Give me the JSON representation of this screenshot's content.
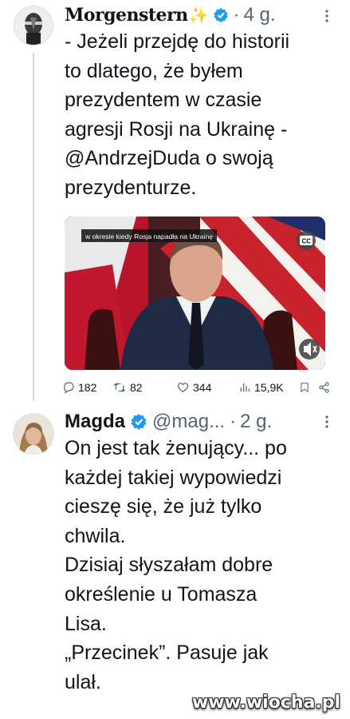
{
  "tweet1": {
    "author_name": "Morgenstern",
    "name_emoji": "✨",
    "time": "4 g.",
    "text_lines": [
      "- Jeżeli przejdę do historii",
      "to dlatego, że byłem",
      "prezydentem w czasie",
      "agresji Rosji na Ukrainę -",
      "@AndrzejDuda o swoją",
      "prezydenturze."
    ],
    "video": {
      "caption": "w okresie kiedy Rosja napadła na Ukrainę",
      "cc_label": "CC"
    },
    "actions": {
      "replies": "182",
      "reposts": "82",
      "likes": "344",
      "views": "15,9K"
    }
  },
  "tweet2": {
    "author_name": "Magda",
    "handle": "@mag...",
    "time": "2 g.",
    "text_lines": [
      "On jest tak żenujący... po",
      "każdej takiej wypowiedzi",
      "cieszę się, że już tylko",
      "chwila.",
      "Dzisiaj słyszałam dobre",
      "określenie u Tomasza",
      "Lisa.",
      "„Przecinek”. Pasuje jak",
      "ulał."
    ]
  },
  "watermark": "www.wiocha.pl",
  "colors": {
    "verified": "#1d9bf0",
    "muted": "#536471",
    "text": "#0f1419"
  }
}
